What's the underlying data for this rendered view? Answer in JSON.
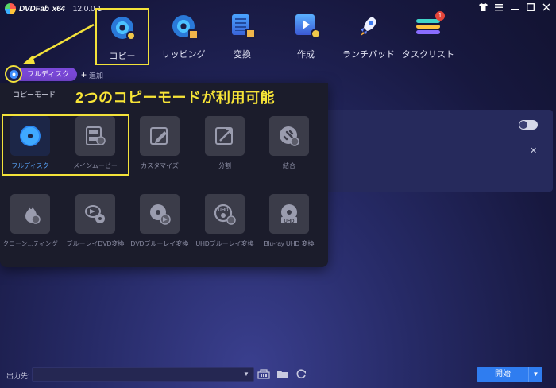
{
  "app": {
    "logo_text": "DVDFab",
    "edition": "x64",
    "version": "12.0.0.1"
  },
  "window_controls": [
    "shirt-icon",
    "menu-icon",
    "minimize-icon",
    "maximize-icon",
    "close-icon"
  ],
  "nav": {
    "items": [
      {
        "label": "コピー",
        "icon": "copy-disc-icon",
        "active": true
      },
      {
        "label": "リッピング",
        "icon": "ripper-icon"
      },
      {
        "label": "変換",
        "icon": "converter-icon"
      },
      {
        "label": "作成",
        "icon": "creator-icon"
      },
      {
        "label": "ランチパッド",
        "icon": "launchpad-rocket-icon"
      },
      {
        "label": "タスクリスト",
        "icon": "tasklist-icon",
        "badge": "1"
      }
    ]
  },
  "mode": {
    "selected": "フルディスク",
    "add_label": "追加"
  },
  "popup": {
    "label": "コピーモード",
    "annotation": "2つのコピーモードが利用可能",
    "tiles_row1": [
      {
        "label": "フルディスク",
        "icon": "full-disc-icon",
        "active": true
      },
      {
        "label": "メインムービー",
        "icon": "main-movie-icon"
      },
      {
        "label": "カスタマイズ",
        "icon": "customize-icon"
      },
      {
        "label": "分割",
        "icon": "split-icon"
      },
      {
        "label": "結合",
        "icon": "merge-icon"
      }
    ],
    "tiles_row2": [
      {
        "label": "クローン...ティング",
        "icon": "clone-burn-icon"
      },
      {
        "label": "ブルーレイDVD変換",
        "icon": "bluray-to-dvd-icon"
      },
      {
        "label": "DVDブルーレイ変換",
        "icon": "dvd-to-bluray-icon"
      },
      {
        "label": "UHDブルーレイ変換",
        "icon": "uhd-to-bluray-icon"
      },
      {
        "label": "Blu-ray UHD 変換",
        "icon": "bluray-to-uhd-icon"
      }
    ]
  },
  "bottom": {
    "output_label": "出力先:",
    "start_label": "開始"
  },
  "colors": {
    "highlight": "#f3e23a",
    "accent_blue": "#2f7df0",
    "mode_purple": "#7a48d8"
  }
}
